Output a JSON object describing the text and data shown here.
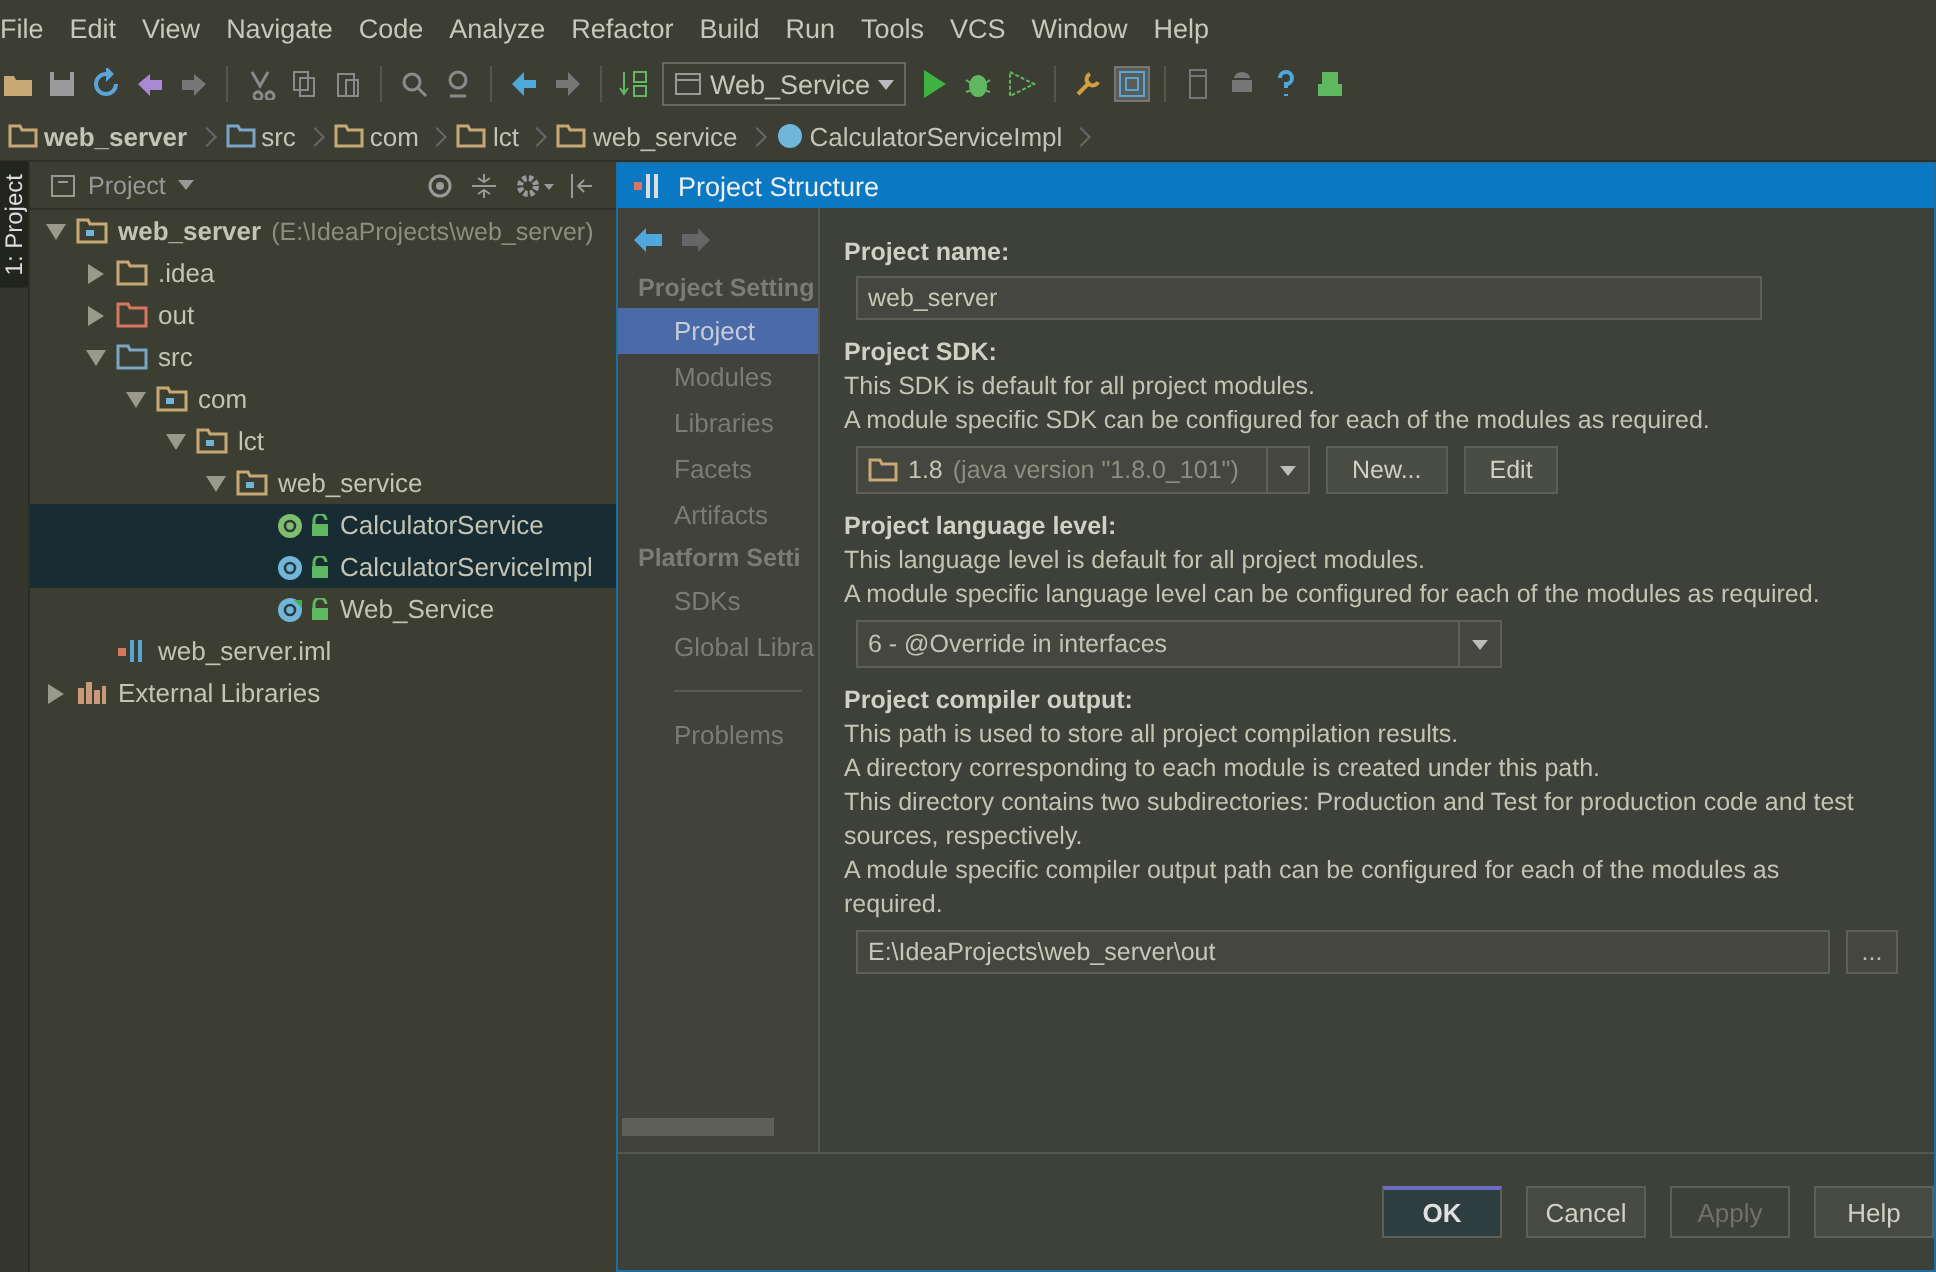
{
  "menu": [
    "File",
    "Edit",
    "View",
    "Navigate",
    "Code",
    "Analyze",
    "Refactor",
    "Build",
    "Run",
    "Tools",
    "VCS",
    "Window",
    "Help"
  ],
  "toolbar": {
    "run_config": "Web_Service"
  },
  "breadcrumb": [
    {
      "label": "web_server",
      "kind": "module"
    },
    {
      "label": "src",
      "kind": "source"
    },
    {
      "label": "com",
      "kind": "package"
    },
    {
      "label": "lct",
      "kind": "package"
    },
    {
      "label": "web_service",
      "kind": "package"
    },
    {
      "label": "CalculatorServiceImpl",
      "kind": "class"
    }
  ],
  "tool_window_tab": {
    "label": "1: Project",
    "selected": true
  },
  "project_panel": {
    "title": "Project",
    "tree": [
      {
        "label": "web_server",
        "path": "(E:\\IdeaProjects\\web_server)",
        "kind": "module",
        "expanded": true,
        "selected": false,
        "children": [
          {
            "label": ".idea",
            "kind": "folder",
            "expanded": false,
            "selected": false
          },
          {
            "label": "out",
            "kind": "excluded",
            "expanded": false,
            "selected": false
          },
          {
            "label": "src",
            "kind": "source",
            "expanded": true,
            "selected": false,
            "children": [
              {
                "label": "com",
                "kind": "package",
                "expanded": true,
                "selected": false,
                "children": [
                  {
                    "label": "lct",
                    "kind": "package",
                    "expanded": true,
                    "selected": false,
                    "children": [
                      {
                        "label": "web_service",
                        "kind": "package",
                        "expanded": true,
                        "selected": false,
                        "children": [
                          {
                            "label": "CalculatorService",
                            "kind": "interface",
                            "selected": true
                          },
                          {
                            "label": "CalculatorServiceImpl",
                            "kind": "class",
                            "selected": true
                          },
                          {
                            "label": "Web_Service",
                            "kind": "main_class",
                            "selected": false
                          }
                        ]
                      }
                    ]
                  }
                ]
              }
            ]
          },
          {
            "label": "web_server.iml",
            "kind": "iml",
            "selected": false
          }
        ]
      },
      {
        "label": "External Libraries",
        "kind": "libraries",
        "expanded": false,
        "selected": false
      }
    ]
  },
  "dialog": {
    "title": "Project Structure",
    "nav": [
      {
        "label": "Project Setting",
        "kind": "header"
      },
      {
        "label": "Project",
        "kind": "item",
        "selected": true
      },
      {
        "label": "Modules",
        "kind": "item",
        "selected": false
      },
      {
        "label": "Libraries",
        "kind": "item",
        "selected": false
      },
      {
        "label": "Facets",
        "kind": "item",
        "selected": false
      },
      {
        "label": "Artifacts",
        "kind": "item",
        "selected": false
      },
      {
        "label": "Platform Setti",
        "kind": "header"
      },
      {
        "label": "SDKs",
        "kind": "item",
        "selected": false
      },
      {
        "label": "Global Libra",
        "kind": "item",
        "selected": false
      },
      {
        "kind": "divider"
      },
      {
        "label": "Problems",
        "kind": "item",
        "selected": false
      }
    ],
    "name_label": "Project name:",
    "name_value": "web_server",
    "sdk_label": "Project SDK:",
    "sdk_text": [
      "This SDK is default for all project modules.",
      "A module specific SDK can be configured for each of the modules as required."
    ],
    "sdk_value": "1.8",
    "sdk_detail": "(java version \"1.8.0_101\")",
    "sdk_buttons": [
      "New...",
      "Edit"
    ],
    "lang_label": "Project language level:",
    "lang_text": [
      "This language level is default for all project modules.",
      "A module specific language level can be configured for each of the modules as required."
    ],
    "lang_value": "6 - @Override in interfaces",
    "output_label": "Project compiler output:",
    "output_text": [
      "This path is used to store all project compilation results.",
      "A directory corresponding to each module is created under this path.",
      "This directory contains two subdirectories: Production and Test for production code and test sources, respectively.",
      "A module specific compiler output path can be configured for each of the modules as required."
    ],
    "output_value": "E:\\IdeaProjects\\web_server\\out",
    "browse": "...",
    "buttons": [
      {
        "label": "OK",
        "kind": "default",
        "disabled": false
      },
      {
        "label": "Cancel",
        "kind": "normal",
        "disabled": false
      },
      {
        "label": "Apply",
        "kind": "normal",
        "disabled": true
      },
      {
        "label": "Help",
        "kind": "normal",
        "disabled": false
      }
    ]
  }
}
